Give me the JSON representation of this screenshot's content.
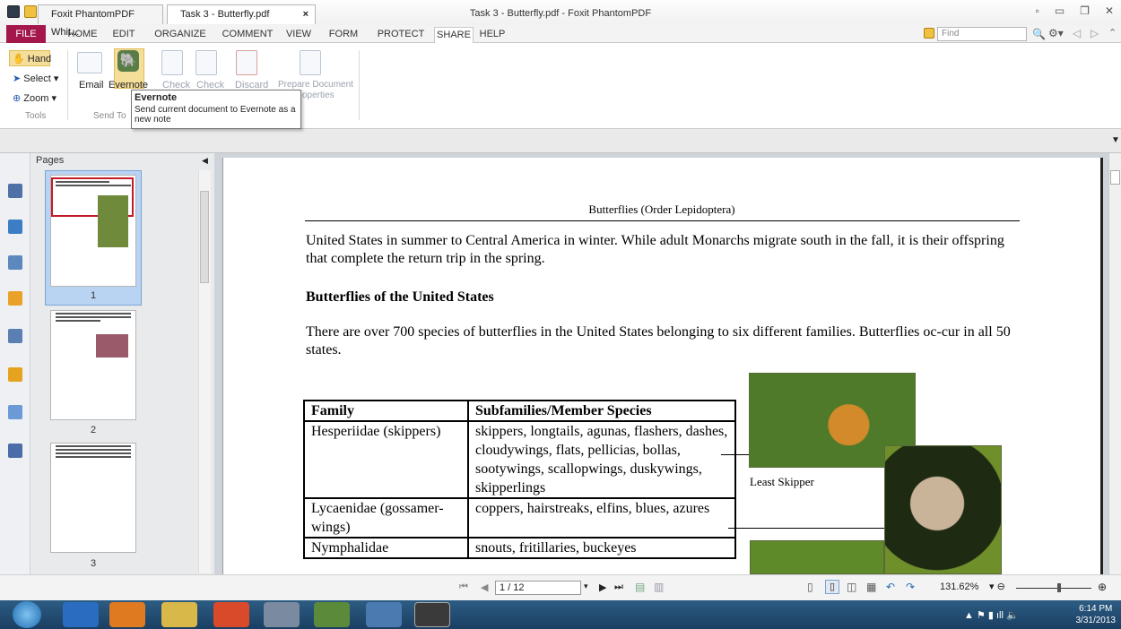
{
  "window": {
    "title": "Task 3 - Butterfly.pdf - Foxit PhantomPDF"
  },
  "menu": {
    "file": "FILE",
    "tabs": [
      "HOME",
      "EDIT",
      "ORGANIZE",
      "COMMENT",
      "VIEW",
      "FORM",
      "PROTECT",
      "SHARE",
      "HELP"
    ],
    "active": "SHARE",
    "find_placeholder": "Find"
  },
  "ribbon": {
    "tools": {
      "hand": "Hand",
      "select": "Select",
      "zoom": "Zoom",
      "group": "Tools"
    },
    "send_to": {
      "email": "Email",
      "evernote": "Evernote",
      "group": "Send To"
    },
    "check_out": "Check",
    "check_in": "Check",
    "discard": "Discard",
    "prepare": "Prepare Document",
    "properties_partial": "operties"
  },
  "tooltip": {
    "title": "Evernote",
    "text": "Send current document to Evernote as a new note"
  },
  "doc_tabs": [
    {
      "label": "Foxit PhantomPDF Whit..."
    },
    {
      "label": "Task 3 - Butterfly.pdf",
      "close": "×"
    }
  ],
  "pages_panel": {
    "header": "Pages",
    "page_numbers": [
      "1",
      "2",
      "3"
    ]
  },
  "document": {
    "header": "Butterflies (Order Lepidoptera)",
    "intro": "United States in summer to Central America in winter.  While adult Monarchs migrate south in the fall, it is their offspring that complete the return trip in the spring.",
    "heading": "Butterflies of the United States",
    "para2": "There are over 700 species of butterflies in the United States belonging to six different families.  Butterflies oc-cur in all 50 states.",
    "table": {
      "headers": [
        "Family",
        "Subfamilies/Member Species"
      ],
      "rows": [
        [
          "Hesperiidae (skippers)",
          "skippers, longtails, agunas, flashers, dashes, cloudywings, flats, pellicias, bollas, sootywings, scallopwings, duskywings, skipperlings"
        ],
        [
          "Lycaenidae (gossamer-wings)",
          "coppers, hairstreaks, elfins, blues, azures"
        ],
        [
          "Nymphalidae",
          "snouts, fritillaries, buckeyes"
        ]
      ]
    },
    "photo_caption": "Least Skipper"
  },
  "statusbar": {
    "page_value": "1 / 12",
    "zoom": "131.62%"
  },
  "taskbar": {
    "time": "6:14 PM",
    "date": "3/31/2013"
  }
}
